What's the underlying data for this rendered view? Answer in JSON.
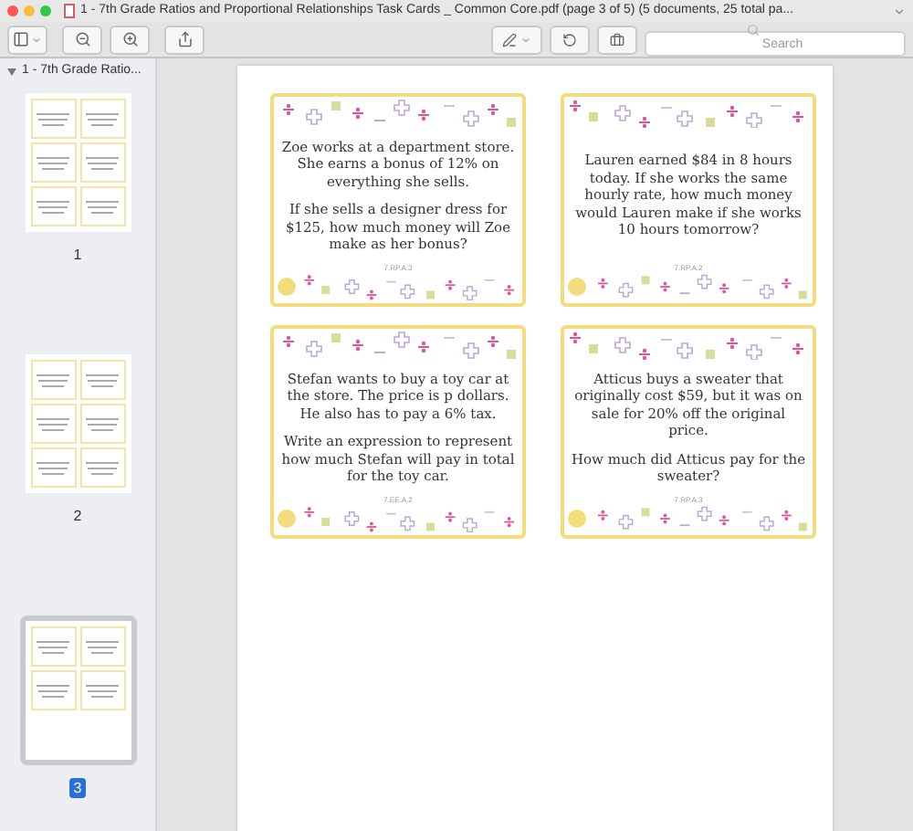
{
  "window": {
    "title": "1 - 7th Grade Ratios and Proportional Relationships Task Cards _ Common Core.pdf (page 3 of 5) (5 documents, 25 total pa..."
  },
  "toolbar": {
    "search": {
      "placeholder": "Search"
    }
  },
  "sidebar": {
    "document": "1 - 7th Grade Ratio...",
    "expanded": true,
    "pages": [
      {
        "label": "1",
        "selected": false
      },
      {
        "label": "2",
        "selected": false
      },
      {
        "label": "3",
        "selected": true
      }
    ]
  },
  "page": {
    "cards": [
      {
        "paragraphs": [
          "Zoe works at a department store. She earns a bonus of 12% on everything she sells.",
          "If she sells a designer dress for $125, how much money will Zoe make as her bonus?"
        ],
        "code": "7.RP.A.3"
      },
      {
        "paragraphs": [
          "Lauren earned $84 in 8 hours today. If she works the same hourly rate, how much money would Lauren make if she works 10 hours tomorrow?"
        ],
        "code": "7.RP.A.2"
      },
      {
        "paragraphs": [
          "Stefan wants to buy a toy car at the store. The price is p dollars. He also has to pay a 6% tax.",
          "Write an expression to represent how much Stefan will pay in total for the toy car."
        ],
        "code": "7.EE.A.2"
      },
      {
        "paragraphs": [
          "Atticus buys a sweater that originally cost $59, but it was on sale for 20% off the original price.",
          "How much did Atticus pay for the sweater?"
        ],
        "code": "7.RP.A.3"
      }
    ]
  }
}
